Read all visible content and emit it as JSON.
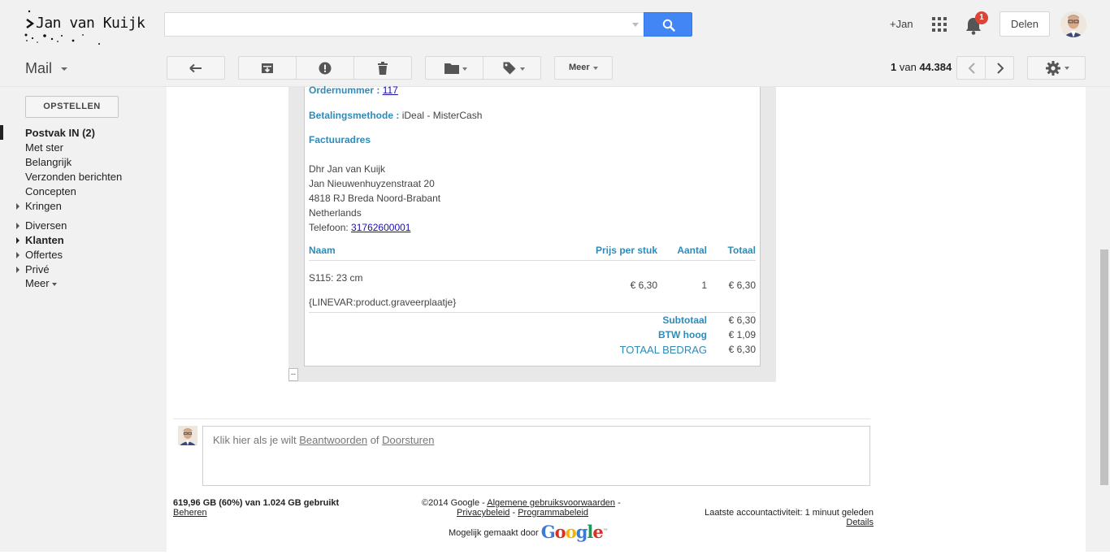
{
  "brand": {
    "logo_text": "Jan van Kuijk"
  },
  "topbar": {
    "search_placeholder": "",
    "user_link": "+Jan",
    "notification_count": "1",
    "share_label": "Delen"
  },
  "toolbar": {
    "app_title": "Mail",
    "more_label": "Meer",
    "pager": {
      "current": "1",
      "of": "van",
      "total": "44.384"
    }
  },
  "sidebar": {
    "compose_label": "OPSTELLEN",
    "items": [
      {
        "label": "Postvak IN (2)",
        "bold": true,
        "active": true
      },
      {
        "label": "Met ster"
      },
      {
        "label": "Belangrijk"
      },
      {
        "label": "Verzonden berichten"
      },
      {
        "label": "Concepten"
      },
      {
        "label": "Kringen",
        "expandable": true
      },
      {
        "label": "Diversen",
        "expandable": true
      },
      {
        "label": "Klanten",
        "expandable": true,
        "bold": true
      },
      {
        "label": "Offertes",
        "expandable": true
      },
      {
        "label": "Privé",
        "expandable": true
      },
      {
        "label": "Meer"
      }
    ]
  },
  "email": {
    "order_label": "Ordernummer :",
    "order_number": "117",
    "payment_label": "Betalingsmethode :",
    "payment_value": "iDeal - MisterCash",
    "invoice_heading": "Factuuradres",
    "address_lines": [
      "Dhr Jan van Kuijk",
      "Jan Nieuwenhuyzenstraat 20",
      "4818 RJ Breda Noord-Brabant",
      "Netherlands"
    ],
    "phone_label": "Telefoon:",
    "phone_value": "31762600001",
    "table": {
      "headers": {
        "name": "Naam",
        "price": "Prijs per stuk",
        "qty": "Aantal",
        "total": "Totaal"
      },
      "rows": [
        {
          "name": "S115: 23 cm",
          "price": "€ 6,30",
          "qty": "1",
          "total": "€ 6,30",
          "note": "{LINEVAR:product.graveerplaatje}"
        }
      ],
      "summary": [
        {
          "label": "Subtotaal",
          "value": "€ 6,30"
        },
        {
          "label": "BTW hoog",
          "value": "€ 1,09"
        },
        {
          "label": "TOTAAL BEDRAG",
          "value": "€ 6,30"
        }
      ]
    },
    "collapse_glyph": "--"
  },
  "reply": {
    "prompt": "Klik hier als je wilt",
    "reply_link": "Beantwoorden",
    "or": "of",
    "forward_link": "Doorsturen"
  },
  "footer": {
    "storage": "619,96 GB (60%) van 1.024 GB gebruikt",
    "manage_link": "Beheren",
    "copyright": "©2014 Google -",
    "terms_link": "Algemene gebruiksvoorwaarden",
    "sep": "-",
    "privacy_link": "Privacybeleid",
    "program_link": "Programmabeleid",
    "powered_by": "Mogelijk gemaakt door",
    "google_word": "Google",
    "last_activity": "Laatste accountactiviteit: 1 minuut geleden",
    "details_link": "Details"
  },
  "colors": {
    "accent_blue": "#4285f4",
    "label_blue": "#2e8bb9",
    "badge_red": "#db4437"
  }
}
